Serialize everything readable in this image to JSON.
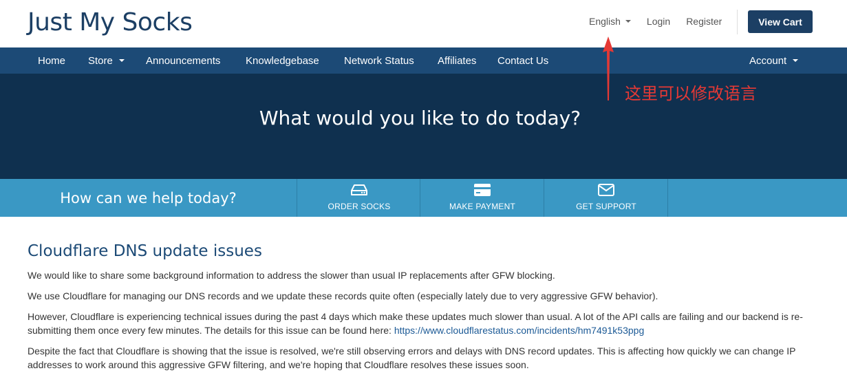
{
  "header": {
    "logo": "Just My Socks",
    "language": "English",
    "login": "Login",
    "register": "Register",
    "view_cart": "View Cart"
  },
  "nav": {
    "items": [
      {
        "label": "Home"
      },
      {
        "label": "Store"
      },
      {
        "label": "Announcements"
      },
      {
        "label": "Knowledgebase"
      },
      {
        "label": "Network Status"
      },
      {
        "label": "Affiliates"
      },
      {
        "label": "Contact Us"
      }
    ],
    "account": "Account"
  },
  "hero": {
    "title": "What would you like to do today?"
  },
  "annotation": {
    "text": "这里可以修改语言",
    "color": "#e53935"
  },
  "helpbar": {
    "label": "How can we help today?",
    "buttons": [
      {
        "label": "ORDER SOCKS",
        "icon": "server-drive-icon"
      },
      {
        "label": "MAKE PAYMENT",
        "icon": "credit-card-icon"
      },
      {
        "label": "GET SUPPORT",
        "icon": "envelope-icon"
      }
    ]
  },
  "announcement": {
    "title": "Cloudflare DNS update issues",
    "p1": "We would like to share some background information to address the slower than usual IP replacements after GFW blocking.",
    "p2": "We use Cloudflare for managing our DNS records and we update these records quite often (especially lately due to very aggressive GFW behavior).",
    "p3": "However, Cloudflare is experiencing technical issues during the past 4 days which make these updates much slower than usual. A lot of the API calls are failing and our backend is re-submitting them once every few minutes. The details for this issue can be found here:",
    "p3_link": "https://www.cloudflarestatus.com/incidents/hm7491k53ppg",
    "p4": "Despite the fact that Cloudflare is showing that the issue is resolved, we're still observing errors and delays with DNS record updates. This is affecting how quickly we can change IP addresses to work around this aggressive GFW filtering, and we're hoping that Cloudflare resolves these issues soon."
  },
  "colors": {
    "brand": "#1c3f64",
    "navbar": "#1c4a76",
    "hero": "#0f304f",
    "helpbar": "#3a98c4"
  }
}
